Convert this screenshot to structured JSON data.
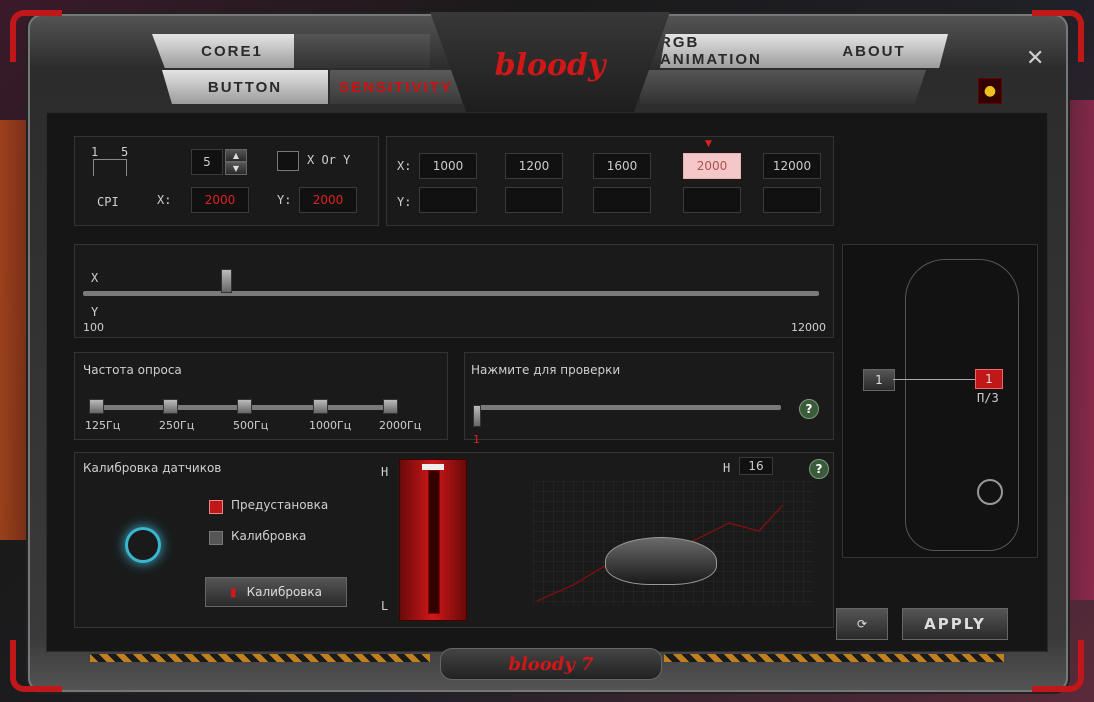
{
  "tabs": {
    "core": "Core1",
    "button": "Button",
    "sensitivity": "Sensitivity",
    "rgb": "RGB Animation",
    "about": "About"
  },
  "logo": "bloody",
  "close": "✕",
  "dpi_panel": {
    "levels_label_from": "1",
    "levels_label_to": "5",
    "level_value": "5",
    "xory_label": "X Or Y",
    "cpi_label": "CPI",
    "x_label": "X:",
    "x_value": "2000",
    "y_label": "Y:",
    "y_value": "2000"
  },
  "presets": {
    "x_label": "X:",
    "y_label": "Y:",
    "x_values": [
      "1000",
      "1200",
      "1600",
      "2000",
      "12000"
    ],
    "selected_index": 3
  },
  "slider": {
    "x_label": "X",
    "y_label": "Y",
    "min": "100",
    "max": "12000"
  },
  "polling": {
    "title": "Частота опроса",
    "options": [
      "125Гц",
      "250Гц",
      "500Гц",
      "1000Гц",
      "2000Гц"
    ]
  },
  "test": {
    "title": "Нажмите для проверки",
    "value": "1"
  },
  "calibration": {
    "title": "Калибровка датчиков",
    "option_preset": "Предустановка",
    "option_calibrate": "Калибровка",
    "button": "Калибровка",
    "h_label": "H",
    "l_label": "L",
    "level_h": "H",
    "level_value": "16"
  },
  "mouse_panel": {
    "button_left": "1",
    "button_right": "1",
    "caption": "П/3"
  },
  "apply": "APPLY",
  "footer": "bloody 7",
  "colors": {
    "accent": "#d01818",
    "panel": "#1a1a1a"
  }
}
